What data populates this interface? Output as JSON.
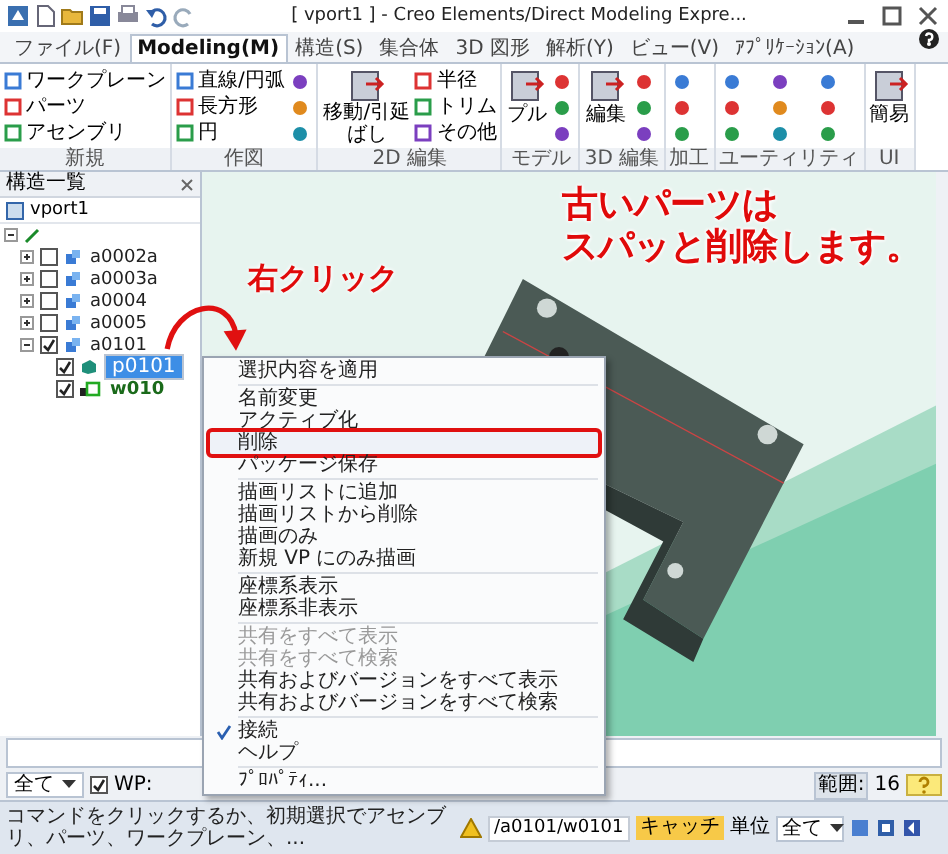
{
  "title_bar": {
    "title": "[ vport1 ] - Creo Elements/Direct Modeling Expre..."
  },
  "tabs": [
    {
      "label": "ファイル(F)",
      "selected": false
    },
    {
      "label": "Modeling(M)",
      "selected": true
    },
    {
      "label": "構造(S)",
      "selected": false
    },
    {
      "label": "集合体",
      "selected": false
    },
    {
      "label": "3D 図形",
      "selected": false
    },
    {
      "label": "解析(Y)",
      "selected": false
    },
    {
      "label": "ビュー(V)",
      "selected": false
    },
    {
      "label": "ｱﾌﾟﾘｹｰｼｮﾝ(A)",
      "selected": false
    }
  ],
  "ribbon": [
    {
      "label": "新規",
      "items": [
        {
          "kind": "row",
          "label": "ワークプレーン"
        },
        {
          "kind": "row",
          "label": "パーツ"
        },
        {
          "kind": "row",
          "label": "アセンブリ"
        }
      ]
    },
    {
      "label": "作図",
      "items": [
        {
          "kind": "row",
          "label": "直線/円弧"
        },
        {
          "kind": "row",
          "label": "長方形"
        },
        {
          "kind": "row",
          "label": "円"
        },
        {
          "kind": "tool"
        },
        {
          "kind": "tool"
        },
        {
          "kind": "tool"
        }
      ]
    },
    {
      "label": "2D 編集",
      "items": [
        {
          "kind": "large",
          "label": "移動/引延ばし"
        },
        {
          "kind": "row",
          "label": "半径"
        },
        {
          "kind": "row",
          "label": "トリム"
        },
        {
          "kind": "row",
          "label": "その他"
        }
      ]
    },
    {
      "label": "モデル",
      "items": [
        {
          "kind": "large",
          "label": "プル"
        },
        {
          "kind": "tool"
        },
        {
          "kind": "tool"
        },
        {
          "kind": "tool"
        }
      ]
    },
    {
      "label": "3D 編集",
      "items": [
        {
          "kind": "large",
          "label": "編集"
        },
        {
          "kind": "tool"
        },
        {
          "kind": "tool"
        },
        {
          "kind": "tool"
        }
      ]
    },
    {
      "label": "加工",
      "items": [
        {
          "kind": "tool"
        },
        {
          "kind": "tool"
        },
        {
          "kind": "tool"
        }
      ]
    },
    {
      "label": "ユーティリティ",
      "items": [
        {
          "kind": "tool"
        },
        {
          "kind": "tool"
        },
        {
          "kind": "tool"
        },
        {
          "kind": "tool"
        },
        {
          "kind": "tool"
        },
        {
          "kind": "tool"
        },
        {
          "kind": "tool"
        },
        {
          "kind": "tool"
        },
        {
          "kind": "tool"
        }
      ]
    },
    {
      "label": "UI",
      "items": [
        {
          "kind": "large",
          "label": "簡易"
        }
      ]
    }
  ],
  "structure_panel": {
    "title": "構造一覧",
    "viewport": "vport1",
    "tree": [
      {
        "expanded": true,
        "kind": "root",
        "children": [
          {
            "label": "a0002a",
            "checked": false,
            "selected": false,
            "expanded": false,
            "expandable": true,
            "kind": "assembly"
          },
          {
            "label": "a0003a",
            "checked": false,
            "selected": false,
            "expanded": false,
            "expandable": true,
            "kind": "assembly"
          },
          {
            "label": "a0004",
            "checked": false,
            "selected": false,
            "expanded": false,
            "expandable": true,
            "kind": "assembly"
          },
          {
            "label": "a0005",
            "checked": false,
            "selected": false,
            "expanded": false,
            "expandable": true,
            "kind": "assembly"
          },
          {
            "label": "a0101",
            "checked": true,
            "selected": false,
            "expanded": true,
            "kind": "assembly",
            "children": [
              {
                "label": "p0101",
                "checked": true,
                "selected": true,
                "kind": "part"
              },
              {
                "label": "w010",
                "checked": true,
                "selected": false,
                "kind": "workplane"
              }
            ]
          }
        ]
      }
    ]
  },
  "context_menu": {
    "groups": [
      [
        {
          "label": "選択内容を適用",
          "disabled": false,
          "checked": false,
          "emphasized": false
        }
      ],
      [
        {
          "label": "名前変更",
          "disabled": false,
          "checked": false,
          "emphasized": false
        },
        {
          "label": "アクティブ化",
          "disabled": false,
          "checked": false,
          "emphasized": false
        },
        {
          "label": "削除",
          "disabled": false,
          "checked": false,
          "emphasized": true
        },
        {
          "label": "パッケージ保存",
          "disabled": false,
          "checked": false,
          "emphasized": false
        }
      ],
      [
        {
          "label": "描画リストに追加",
          "disabled": false,
          "checked": false,
          "emphasized": false
        },
        {
          "label": "描画リストから削除",
          "disabled": false,
          "checked": false,
          "emphasized": false
        },
        {
          "label": "描画のみ",
          "disabled": false,
          "checked": false,
          "emphasized": false
        },
        {
          "label": "新規 VP にのみ描画",
          "disabled": false,
          "checked": false,
          "emphasized": false
        }
      ],
      [
        {
          "label": "座標系表示",
          "disabled": false,
          "checked": false,
          "emphasized": false
        },
        {
          "label": "座標系非表示",
          "disabled": false,
          "checked": false,
          "emphasized": false
        }
      ],
      [
        {
          "label": "共有をすべて表示",
          "disabled": true,
          "checked": false,
          "emphasized": false
        },
        {
          "label": "共有をすべて検索",
          "disabled": true,
          "checked": false,
          "emphasized": false
        },
        {
          "label": "共有およびバージョンをすべて表示",
          "disabled": false,
          "checked": false,
          "emphasized": false
        },
        {
          "label": "共有およびバージョンをすべて検索",
          "disabled": false,
          "checked": false,
          "emphasized": false
        }
      ],
      [
        {
          "label": "接続",
          "disabled": false,
          "checked": true,
          "emphasized": false
        },
        {
          "label": "ヘルプ",
          "disabled": false,
          "checked": false,
          "emphasized": false
        }
      ],
      [
        {
          "label": "ﾌﾟﾛﾊﾟﾃｨ...",
          "disabled": false,
          "checked": false,
          "emphasized": false
        }
      ]
    ]
  },
  "annotations": {
    "right_click": "右クリック",
    "headline": [
      "古いパーツは",
      "スパッと削除します。"
    ]
  },
  "toolbar": {
    "filter": "全て",
    "wp_checked": true,
    "wp_label": "WP:",
    "range_label": "範囲:",
    "range_value": "16"
  },
  "status_bar": {
    "message": "コマンドをクリックするか、初期選択でアセンブリ、パーツ、ワークプレーン、...",
    "path": "/a0101/w0101",
    "catch": "キャッチ",
    "unit_label": "単位",
    "unit_value": "全て"
  }
}
